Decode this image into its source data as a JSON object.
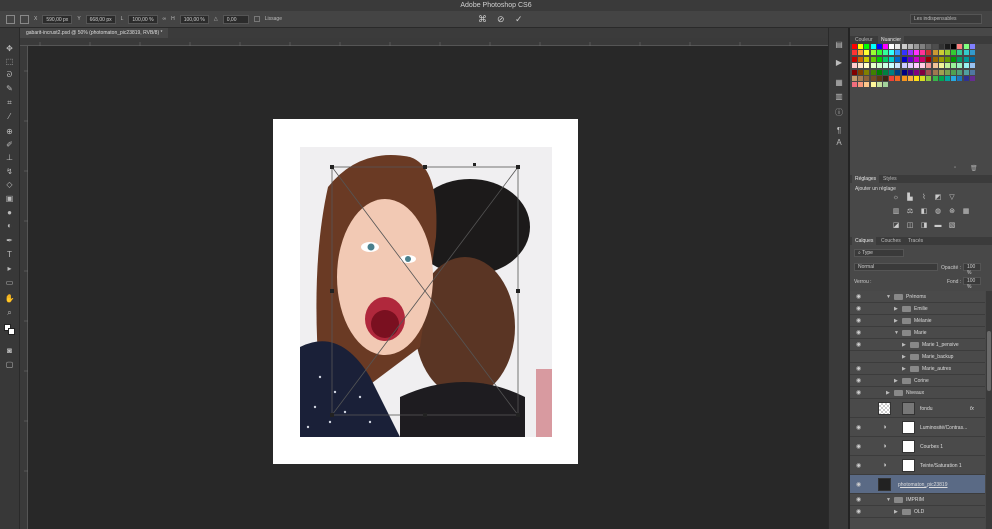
{
  "app": {
    "title": "Adobe Photoshop CS6"
  },
  "options": {
    "x_label": "X",
    "x_value": "590,00 px",
    "y_label": "Y",
    "y_value": "668,00 px",
    "w_label": "L",
    "w_value": "100,00 %",
    "h_label": "H",
    "h_value": "100,00 %",
    "angle_label": "△",
    "angle_value": "0,00",
    "interp_label": "Lissage",
    "workspace": "Les indispensables"
  },
  "document": {
    "tab_title": "gabarit-incrust2.psd @ 50% (photomaton_pic23819, RVB/8) *"
  },
  "panels": {
    "color_tabs": [
      "Couleur",
      "Nuancier"
    ],
    "adjust_tabs": [
      "Réglages",
      "Styles"
    ],
    "adjust_title": "Ajouter un réglage",
    "layer_tabs": [
      "Calques",
      "Couches",
      "Tracés"
    ],
    "filter_kind": "Type",
    "blend_mode": "Normal",
    "opacity_label": "Opacité :",
    "opacity_value": "100 %",
    "lock_label": "Verrou :",
    "fill_label": "Fond :",
    "fill_value": "100 %"
  },
  "layers": [
    {
      "name": "Prénoms",
      "indent": 0,
      "type": "group",
      "open": true,
      "visible": true
    },
    {
      "name": "Emilie",
      "indent": 1,
      "type": "group",
      "open": false,
      "visible": true
    },
    {
      "name": "Mélanie",
      "indent": 1,
      "type": "group",
      "open": false,
      "visible": true
    },
    {
      "name": "Marie",
      "indent": 1,
      "type": "group",
      "open": true,
      "visible": true
    },
    {
      "name": "Marie 1_pensive",
      "indent": 2,
      "type": "group",
      "open": false,
      "visible": true
    },
    {
      "name": "Marie_backup",
      "indent": 2,
      "type": "group",
      "open": false,
      "visible": false
    },
    {
      "name": "Marie_autres",
      "indent": 2,
      "type": "group",
      "open": false,
      "visible": true
    },
    {
      "name": "Corine",
      "indent": 1,
      "type": "group",
      "open": false,
      "visible": true
    },
    {
      "name": "Niveaux",
      "indent": 0,
      "type": "group",
      "open": false,
      "visible": true
    },
    {
      "name": "fondu",
      "indent": 0,
      "type": "smart",
      "visible": false,
      "fx": "fx"
    },
    {
      "name": "Luminosité/Contras...",
      "indent": 0,
      "type": "adjust",
      "visible": true
    },
    {
      "name": "Courbes 1",
      "indent": 0,
      "type": "adjust",
      "visible": true
    },
    {
      "name": "Teinte/Saturation 1",
      "indent": 0,
      "type": "adjust",
      "visible": true
    },
    {
      "name": "photomaton_pic23819",
      "indent": 0,
      "type": "image",
      "visible": true,
      "selected": true
    },
    {
      "name": "IMPRIM",
      "indent": 0,
      "type": "group",
      "open": true,
      "visible": true
    },
    {
      "name": "OLD",
      "indent": 1,
      "type": "group",
      "open": false,
      "visible": true
    }
  ],
  "colors": {
    "accent_selected": "#5a6a85",
    "panel_bg": "#484848",
    "canvas_bg": "#282828"
  }
}
